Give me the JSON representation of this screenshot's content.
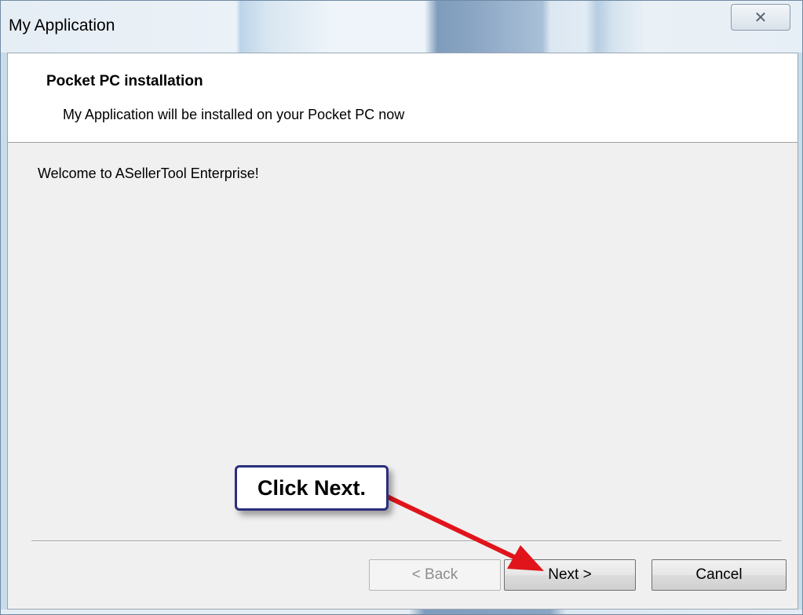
{
  "window": {
    "title": "My Application",
    "close_glyph": "✕"
  },
  "header": {
    "title": "Pocket PC installation",
    "subtitle": "My Application will be installed on your Pocket PC now"
  },
  "body": {
    "message": "Welcome to ASellerTool Enterprise!"
  },
  "buttons": {
    "back": "< Back",
    "next": "Next >",
    "cancel": "Cancel"
  },
  "annotation": {
    "callout_text": "Click Next.",
    "arrow_color": "#e0141a",
    "border_color": "#2b2f7a"
  }
}
